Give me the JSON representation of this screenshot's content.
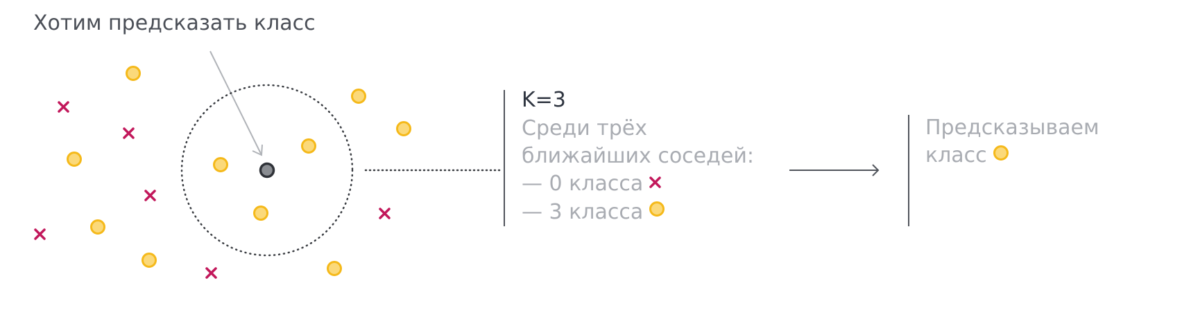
{
  "title": "Хотим предсказать класс",
  "k_label": "K=3",
  "neighbors_heading_line1": "Среди трёх",
  "neighbors_heading_line2": "ближайших соседей:",
  "class0_line": "— 0 класса",
  "class1_line": "— 3 класса",
  "result_line1": "Предсказываем",
  "result_line2": "класс",
  "colors": {
    "cross": "#c2185b",
    "circle_fill": "#fbd97a",
    "circle_stroke": "#f5b91a",
    "query_fill": "#8a8d92",
    "query_stroke": "#2f3238",
    "text_dark": "#2f3540",
    "text_light": "#a9acb2",
    "line": "#50545b"
  },
  "icons": {
    "class_0": "cross-icon",
    "class_1": "circle-icon",
    "query": "query-point-icon"
  }
}
